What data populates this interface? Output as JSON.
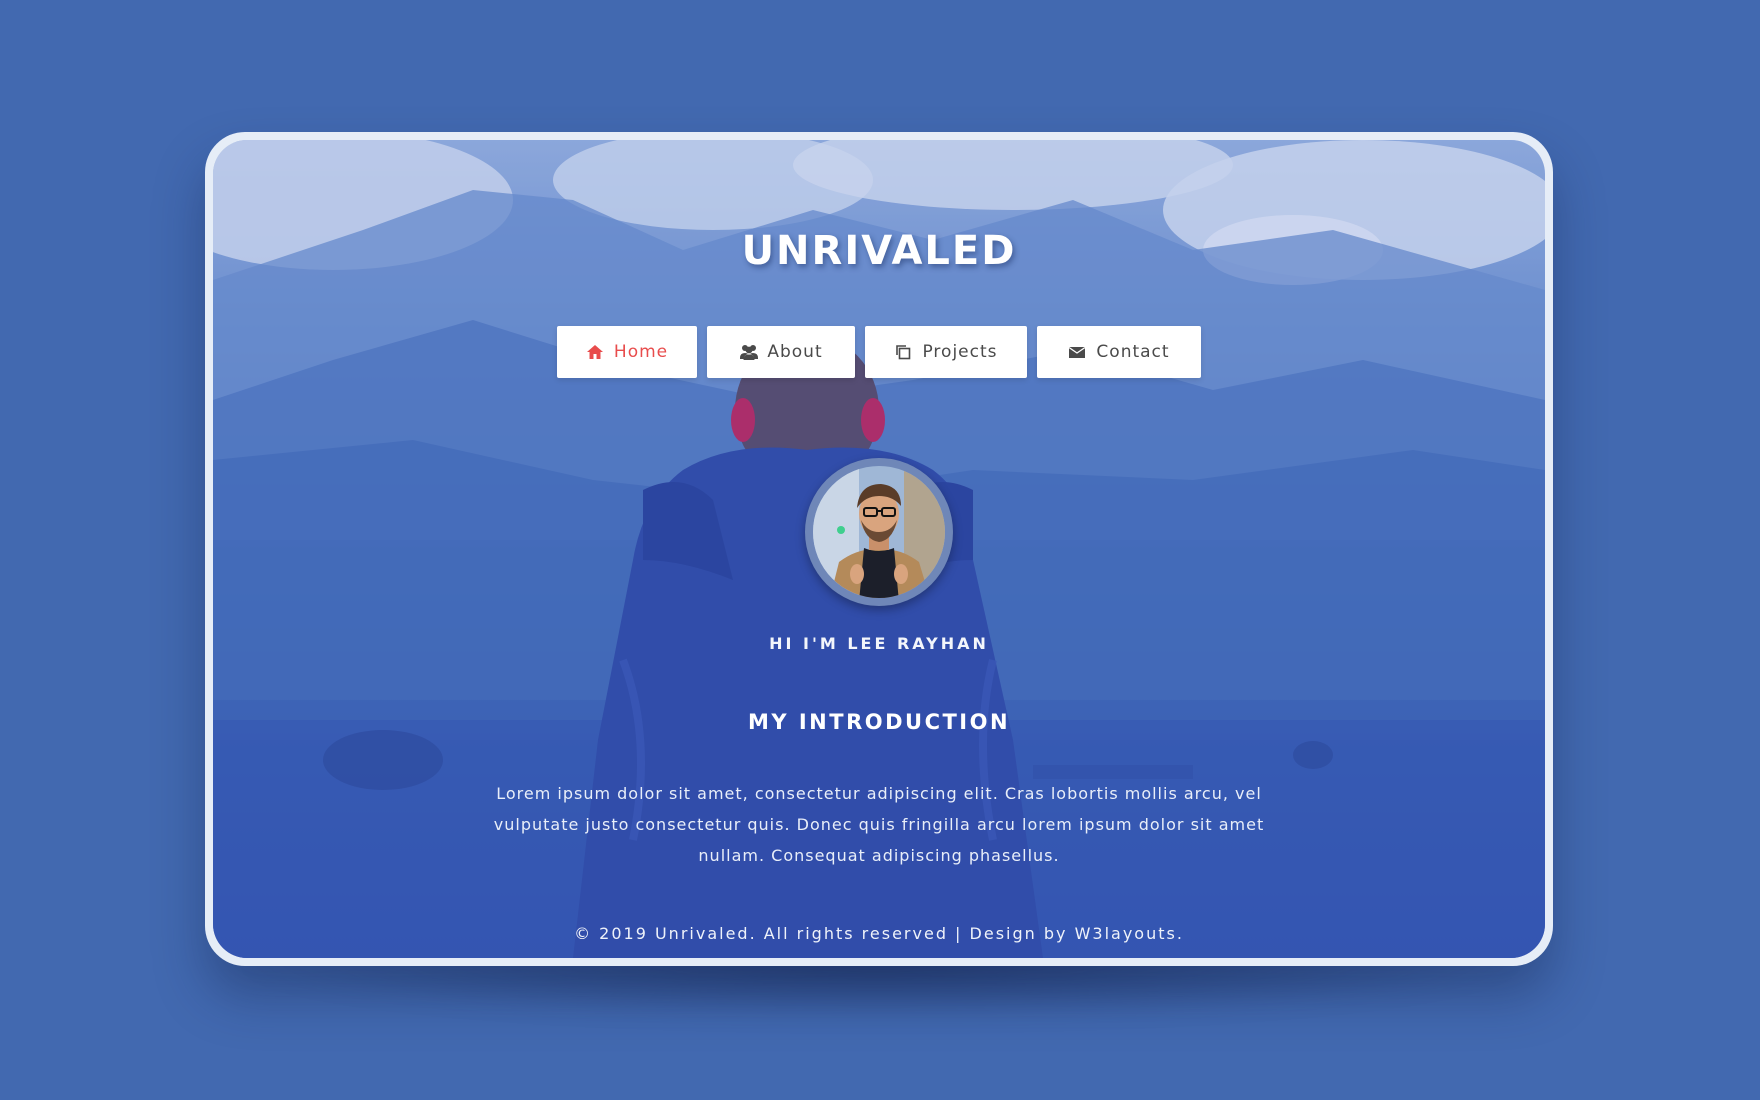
{
  "site": {
    "brand": "UNRIVALED"
  },
  "nav": {
    "items": [
      {
        "label": "Home",
        "icon": "home-icon",
        "active": true
      },
      {
        "label": "About",
        "icon": "users-icon",
        "active": false
      },
      {
        "label": "Projects",
        "icon": "copy-icon",
        "active": false
      },
      {
        "label": "Contact",
        "icon": "envelope-icon",
        "active": false
      }
    ]
  },
  "profile": {
    "greeting": "HI I'M LEE RAYHAN"
  },
  "intro": {
    "title": "MY INTRODUCTION",
    "text": "Lorem ipsum dolor sit amet, consectetur adipiscing elit. Cras lobortis mollis arcu, vel vulputate justo consectetur quis. Donec quis fringilla arcu lorem ipsum dolor sit amet nullam. Consequat adipiscing phasellus."
  },
  "footer": {
    "text": "© 2019 Unrivaled. All rights reserved | Design by W3layouts."
  },
  "colors": {
    "page_bg": "#4269b0",
    "accent": "#e84c4c",
    "button_bg": "#ffffff"
  }
}
